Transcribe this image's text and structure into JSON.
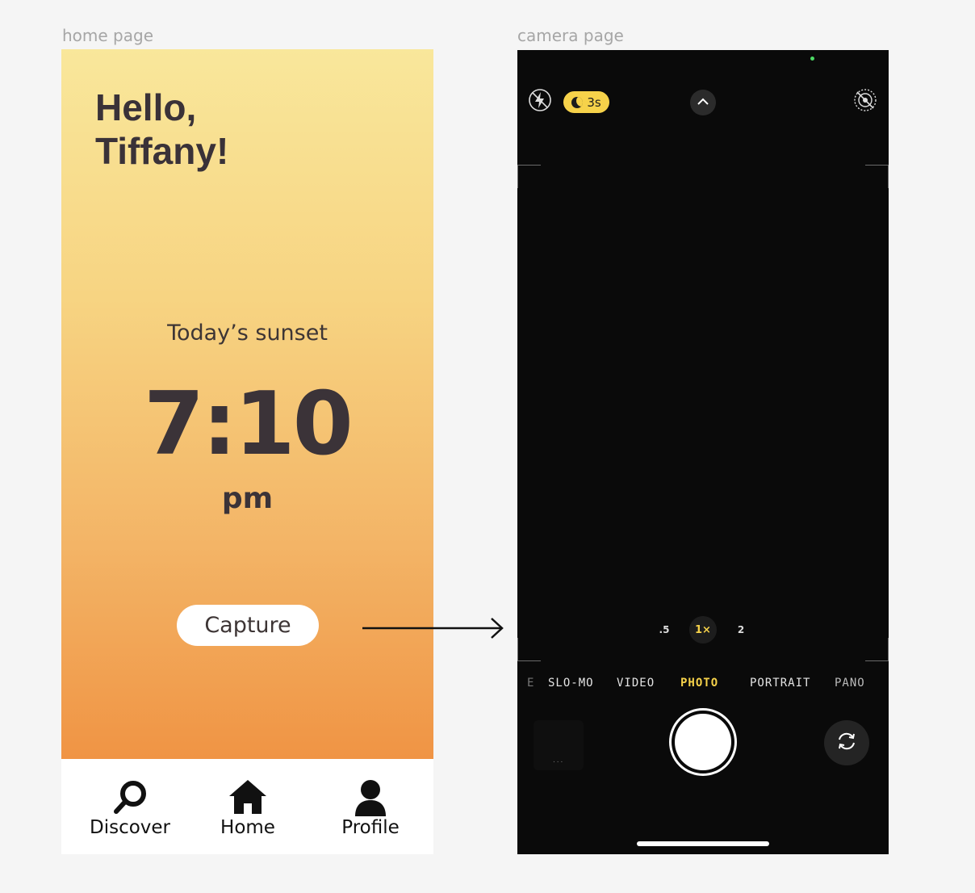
{
  "frames": {
    "home_label": "home page",
    "camera_label": "camera page"
  },
  "home": {
    "greeting_line1": "Hello,",
    "greeting_line2": "Tiffany!",
    "sunset_label": "Today’s sunset",
    "sunset_time": "7:10",
    "sunset_ampm": "pm",
    "capture_label": "Capture",
    "gradient_colors": [
      "#f9e79b",
      "#f09444"
    ],
    "tabs": [
      {
        "label": "Discover",
        "icon": "search-icon"
      },
      {
        "label": "Home",
        "icon": "home-icon"
      },
      {
        "label": "Profile",
        "icon": "user-icon"
      }
    ]
  },
  "camera": {
    "timer_label": "3s",
    "zoom_levels": [
      ".5",
      "1×",
      "2"
    ],
    "active_zoom": "1×",
    "modes": [
      "E",
      "SLO-MO",
      "VIDEO",
      "PHOTO",
      "PORTRAIT",
      "PANO"
    ],
    "active_mode": "PHOTO",
    "accent_color": "#f6d24a",
    "thumbnail_dots": "..."
  }
}
